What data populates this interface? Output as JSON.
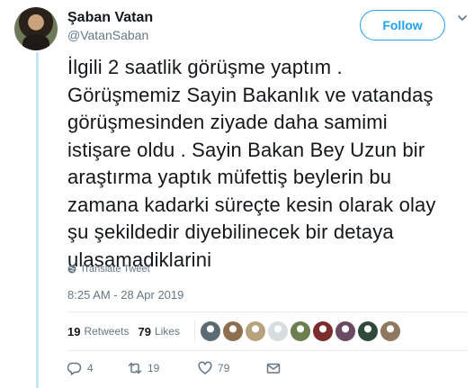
{
  "author": {
    "name": "Şaban Vatan",
    "handle": "@VatanSaban"
  },
  "follow_label": "Follow",
  "tweet": {
    "text": "İlgili 2 saatlik görüşme yaptım .\nGörüşmemiz Sayin Bakanlık ve vatandaş\ngörüşmesinden ziyade daha samimi\nistişare oldu . Sayin Bakan Bey Uzun bir\naraştırma yaptık müfettiş beylerin bu\nzamana kadarki süreçte kesin olarak olay\nşu şekildedir diyebilinecek bir detaya\nulasamadiklarini",
    "translate_label": "Translate Tweet",
    "timestamp": "8:25 AM - 28 Apr 2019"
  },
  "stats": {
    "retweets_count": "19",
    "retweets_label": "Retweets",
    "likes_count": "79",
    "likes_label": "Likes"
  },
  "likers_colors": [
    "#5b6b74",
    "#8d6e4f",
    "#b7a27d",
    "#d8dde0",
    "#6c7f4f",
    "#7b2c2c",
    "#6b4a63",
    "#2f4a3b",
    "#8f7760"
  ],
  "actions": {
    "reply_count": "4",
    "retweet_count": "19",
    "like_count": "79"
  },
  "colors": {
    "accent": "#1da1f2",
    "thread_line": "#c3e6f7",
    "muted": "#657786"
  }
}
